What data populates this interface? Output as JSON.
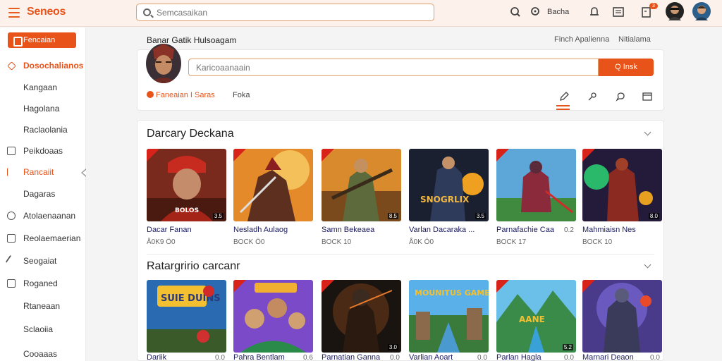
{
  "topbar": {
    "logo": "Seneos",
    "search_placeholder": "Semcasaikan",
    "help_label": "Bacha",
    "notification_count": "3"
  },
  "sidebar": {
    "cta": "Fencaian",
    "items": [
      {
        "label": "Dosochalianos",
        "icon": "diamond-icon"
      },
      {
        "label": "Kangaan",
        "icon": ""
      },
      {
        "label": "Hagolana",
        "icon": ""
      },
      {
        "label": "Raclaolania",
        "icon": ""
      },
      {
        "label": "Peikdoaas",
        "icon": "square-icon"
      },
      {
        "label": "Rancaiit",
        "icon": "bracket-icon"
      },
      {
        "label": "Dagaras",
        "icon": ""
      },
      {
        "label": "Atolaenaanan",
        "icon": "people-icon"
      },
      {
        "label": "Reolaemaerian",
        "icon": "monitor-icon"
      },
      {
        "label": "Seogaiat",
        "icon": "pen-icon"
      },
      {
        "label": "Roganed",
        "icon": "shield-icon"
      },
      {
        "label": "Rtaneaan",
        "icon": ""
      },
      {
        "label": "Sclaoiia",
        "icon": ""
      },
      {
        "label": "Cooaaas",
        "icon": ""
      }
    ]
  },
  "header": {
    "breadcrumb": "Banar Gatik Hulsoagam",
    "link_1": "Finch Apalienna",
    "link_2": "Nitialama"
  },
  "composer": {
    "placeholder": "Karicoaanaain",
    "button": "Q Insk",
    "tab_active": "Faneaian I Saras",
    "tab_other": "Foka"
  },
  "sections": [
    {
      "title": "Darcary Deckana",
      "games": [
        {
          "title": "Dacar Fanan",
          "meta": "Å0K9 Ö0",
          "num": ""
        },
        {
          "title": "Nesladh Aulaog",
          "meta": "BOCK Ö0",
          "num": ""
        },
        {
          "title": "Samn Bekeaea",
          "meta": "BOCK 10",
          "num": ""
        },
        {
          "title": "Varlan Dacaraka ...",
          "meta": "Å0K Ö0",
          "num": ""
        },
        {
          "title": "Parnafachie Caa",
          "meta": "BOCK 17",
          "num": "0.2"
        },
        {
          "title": "Mahmiaisn Nes",
          "meta": "BOCK 10",
          "num": ""
        }
      ]
    },
    {
      "title": "Ratargririo carcanr",
      "games": [
        {
          "title": "Dariik",
          "meta": "",
          "num": "0.0"
        },
        {
          "title": "Pahra Bentlam",
          "meta": "",
          "num": "0.6"
        },
        {
          "title": "Parnatian Ganna",
          "meta": "",
          "num": "0.0"
        },
        {
          "title": "Varlian Aoart",
          "meta": "",
          "num": "0.0"
        },
        {
          "title": "Parlan Hagla",
          "meta": "",
          "num": "0.0"
        },
        {
          "title": "Marnari Deaon",
          "meta": "",
          "num": "0.0"
        }
      ]
    }
  ],
  "tile_labels": {
    "t1": "3.5",
    "t2": "",
    "t3": "8.5",
    "t4": "3.5",
    "t5": "0.5",
    "t6": "8.0",
    "t9": "3.0",
    "t11": "5.2"
  },
  "tile_texts": {
    "t4": "SNOGRLIX",
    "t7": "SUIE DUINS",
    "t10": "MOUNITUS GAME",
    "t11b": "AANE"
  },
  "colors": {
    "accent": "#e8531a",
    "title_text": "#1a1a60"
  }
}
